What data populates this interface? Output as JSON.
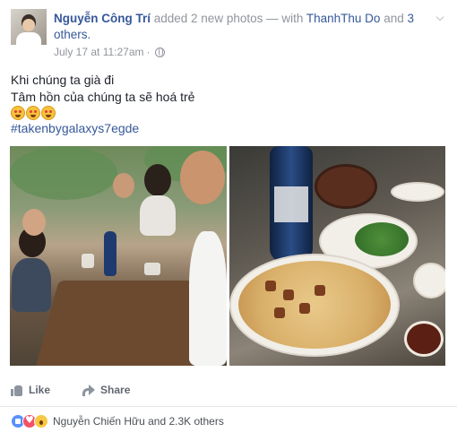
{
  "post": {
    "author": "Nguyễn Công Trí",
    "action": " added 2 new photos — with ",
    "tagged_friend": "ThanhThu Do",
    "and_text": " and ",
    "others": "3 others.",
    "date": "July 17 at 11:27am",
    "dot": " · ",
    "privacy_icon": "globe-icon",
    "menu_icon": "chevron-down-icon",
    "message_line1": "Khi chúng ta già đi",
    "message_line2": "Tâm hồn của chúng ta sẽ hoá trẻ",
    "emoji_icon": "grinning-face-emoji",
    "hashtag": "#takenbygalaxys7egde"
  },
  "actions": {
    "like_label": "Like",
    "share_label": "Share"
  },
  "reactions": {
    "icons": [
      "like-reaction-icon",
      "love-reaction-icon",
      "wow-reaction-icon"
    ],
    "summary": "Nguyễn Chiến Hữu and 2.3K others"
  },
  "colors": {
    "link": "#365899",
    "meta": "#90949c",
    "text": "#1d2129",
    "action": "#616770"
  }
}
